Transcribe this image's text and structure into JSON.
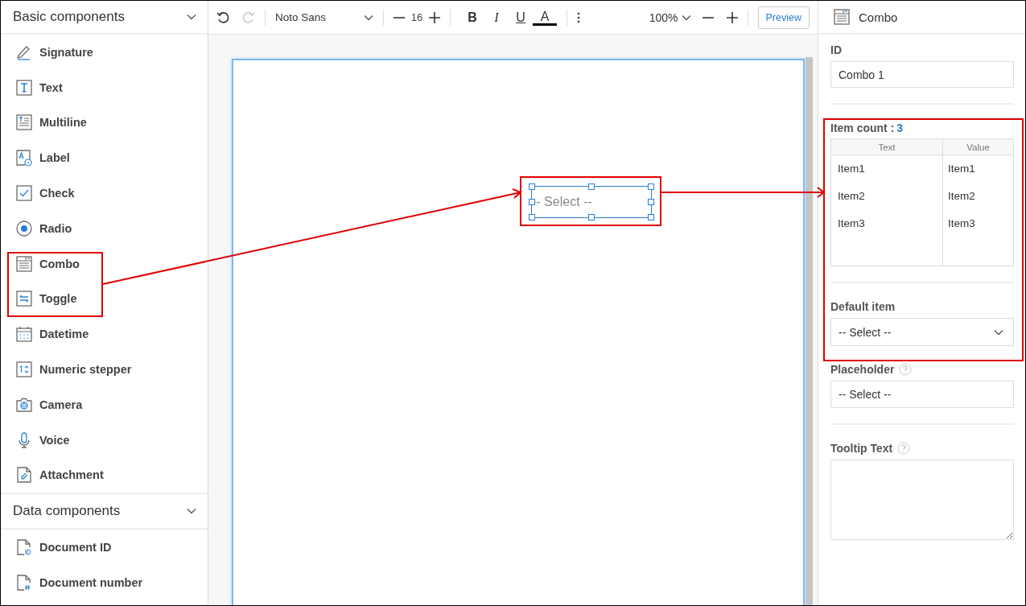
{
  "sidebar": {
    "sections": [
      {
        "title": "Basic components",
        "expanded": true,
        "items": [
          {
            "label": "Signature",
            "kind": "signature"
          },
          {
            "label": "Text",
            "kind": "text"
          },
          {
            "label": "Multiline",
            "kind": "multiline"
          },
          {
            "label": "Label",
            "kind": "label"
          },
          {
            "label": "Check",
            "kind": "check"
          },
          {
            "label": "Radio",
            "kind": "radio"
          },
          {
            "label": "Combo",
            "kind": "combo"
          },
          {
            "label": "Toggle",
            "kind": "toggle"
          },
          {
            "label": "Datetime",
            "kind": "datetime"
          },
          {
            "label": "Numeric stepper",
            "kind": "numeric"
          },
          {
            "label": "Camera",
            "kind": "camera"
          },
          {
            "label": "Voice",
            "kind": "voice"
          },
          {
            "label": "Attachment",
            "kind": "attachment"
          }
        ]
      },
      {
        "title": "Data components",
        "expanded": true,
        "items": [
          {
            "label": "Document ID",
            "kind": "document-id"
          },
          {
            "label": "Document number",
            "kind": "document-number"
          }
        ]
      }
    ]
  },
  "toolbar": {
    "redo_disabled": true,
    "font": "Noto Sans",
    "font_size": "16",
    "format_buttons": [
      {
        "label": "B",
        "kind": "bold"
      },
      {
        "label": "I",
        "kind": "italic"
      },
      {
        "label": "U",
        "kind": "underline"
      },
      {
        "label": "A",
        "kind": "color",
        "color": "#000000"
      }
    ],
    "zoom": "100%",
    "preview": "Preview"
  },
  "canvas": {
    "combo": {
      "placeholder": "-- Select --",
      "selected": true
    }
  },
  "properties": {
    "title": "Combo",
    "id_label": "ID",
    "id_value": "Combo 1",
    "item_count_label": "Item count :",
    "item_count": "3",
    "columns": [
      "Text",
      "Value"
    ],
    "rows": [
      [
        "Item1",
        "Item1"
      ],
      [
        "Item2",
        "Item2"
      ],
      [
        "Item3",
        "Item3"
      ]
    ],
    "default_item_label": "Default item",
    "default_item_value": "-- Select --",
    "placeholder_label": "Placeholder",
    "placeholder_value": "-- Select --",
    "tooltip_label": "Tooltip Text"
  }
}
